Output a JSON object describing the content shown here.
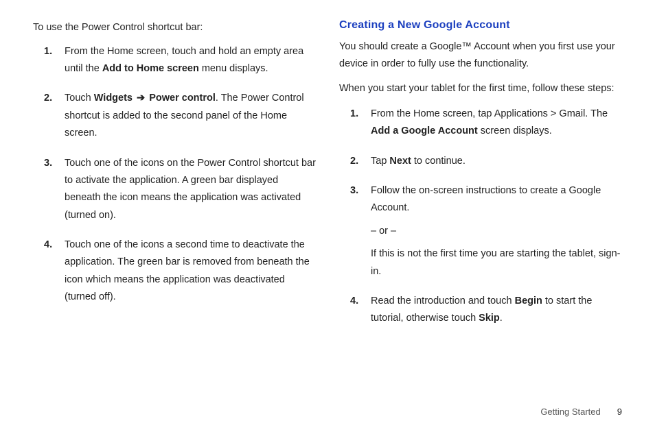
{
  "left": {
    "intro": "To use the Power Control shortcut bar:",
    "steps": [
      {
        "pre": "From the Home screen, touch and hold an empty area until the ",
        "b1": "Add to Home screen",
        "post": " menu displays."
      },
      {
        "pre": "Touch ",
        "b1": "Widgets",
        "arrow": "➔",
        "b2": "Power control",
        "post": ". The Power Control shortcut is added to the second panel of the Home screen."
      },
      {
        "text": "Touch one of the icons on the Power Control shortcut bar to activate the application. A green bar displayed beneath the icon means the application was activated (turned on)."
      },
      {
        "text": "Touch one of the icons a second time to deactivate the application. The green bar is removed from beneath the icon which means the application was deactivated (turned off)."
      }
    ]
  },
  "right": {
    "heading": "Creating a New Google Account",
    "p1": "You should create a Google™ Account when you first use your device in order to fully use the functionality.",
    "p2": "When you start your tablet for the first time, follow these steps:",
    "steps": [
      {
        "pre": "From the Home screen, tap Applications > Gmail. The ",
        "b1": "Add a Google Account",
        "post": " screen displays."
      },
      {
        "pre": "Tap ",
        "b1": "Next",
        "post": " to continue."
      },
      {
        "text": "Follow the on-screen instructions to create a Google Account.",
        "or": "– or –",
        "alt": "If this is not the first time you are starting the tablet, sign-in."
      },
      {
        "pre": "Read the introduction and touch ",
        "b1": "Begin",
        "mid": " to start the tutorial, otherwise touch ",
        "b2": "Skip",
        "post": "."
      }
    ]
  },
  "footer": {
    "section": "Getting Started",
    "page": "9"
  }
}
